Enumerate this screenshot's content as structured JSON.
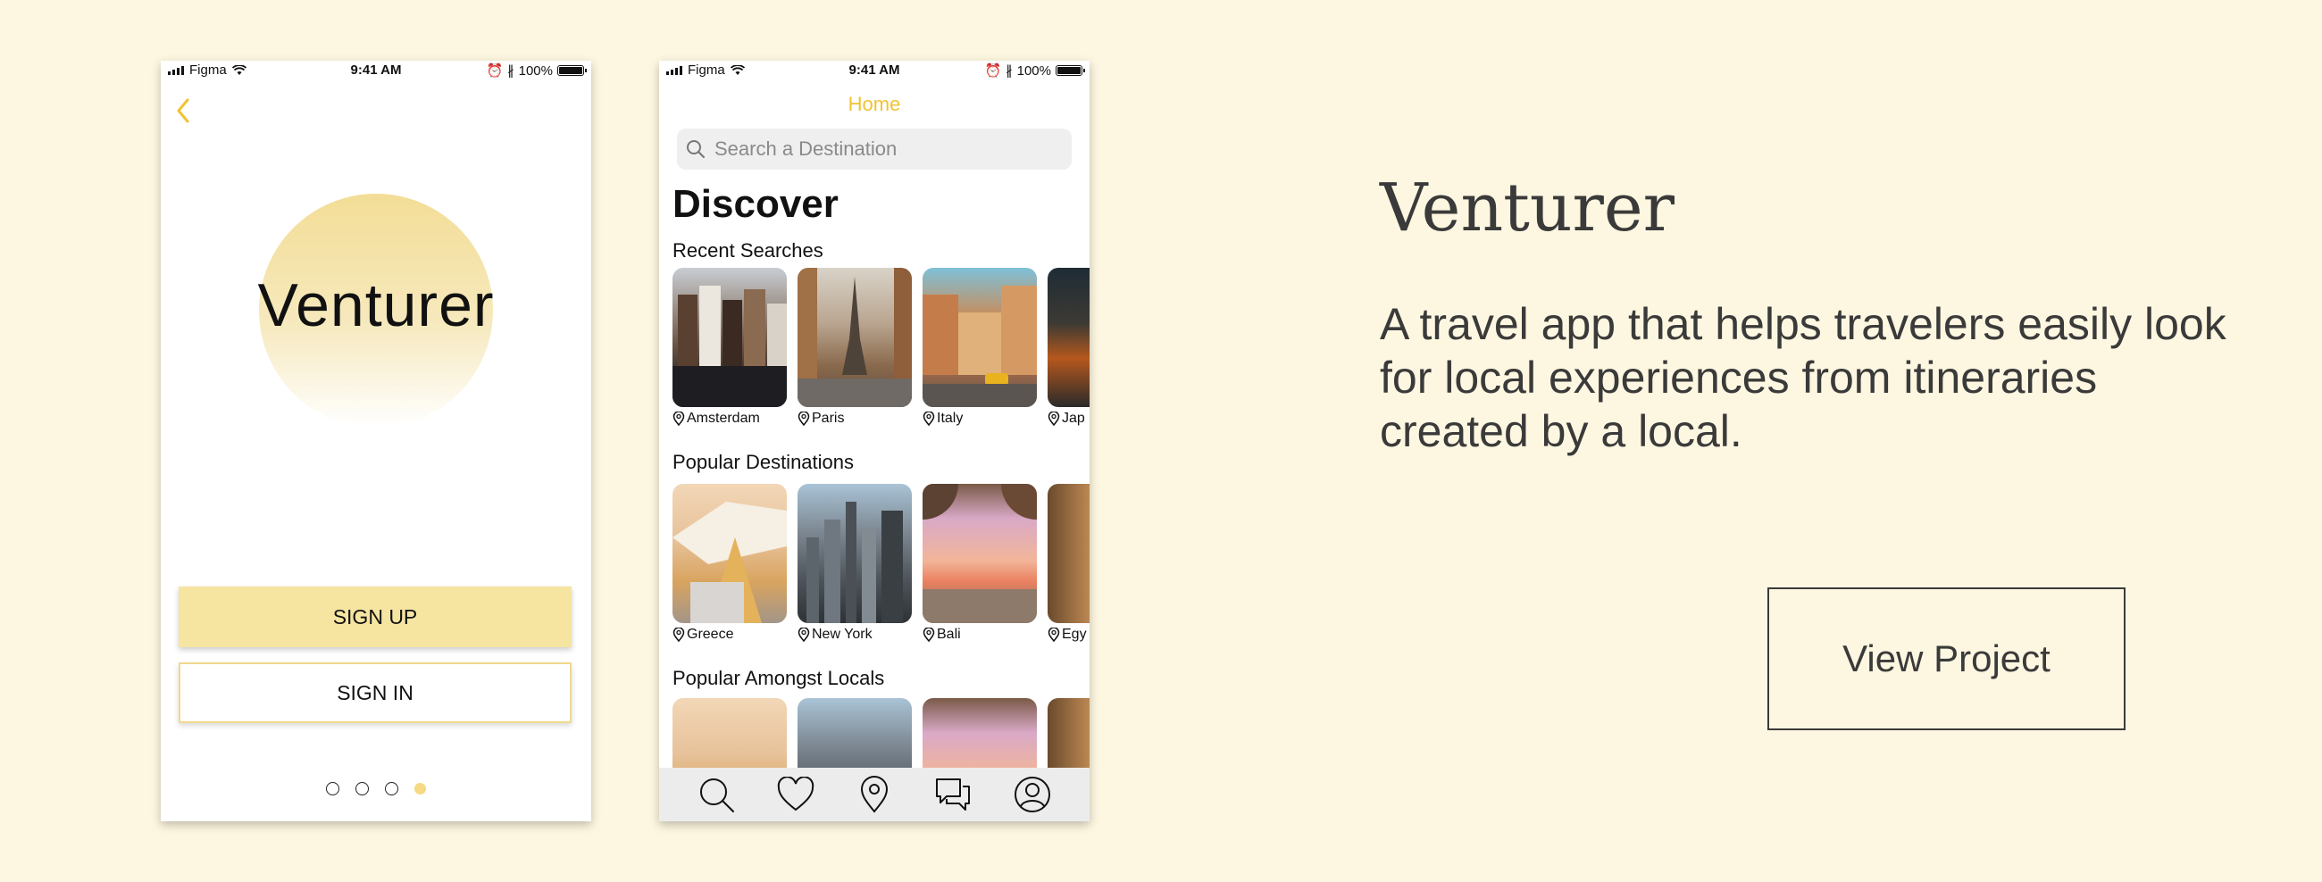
{
  "status_bar": {
    "carrier": "Figma",
    "time": "9:41 AM",
    "battery": "100%"
  },
  "splash": {
    "logo_text": "Venturer",
    "signup_label": "SIGN UP",
    "signin_label": "SIGN IN",
    "page_dots": 4,
    "active_dot": 4
  },
  "home": {
    "title": "Home",
    "search_placeholder": "Search a Destination",
    "heading": "Discover",
    "sections": [
      {
        "title": "Recent Searches",
        "items": [
          "Amsterdam",
          "Paris",
          "Italy",
          "Jap"
        ]
      },
      {
        "title": "Popular Destinations",
        "items": [
          "Greece",
          "New York",
          "Bali",
          "Egy"
        ]
      },
      {
        "title": "Popular Amongst Locals",
        "items": [
          "",
          "",
          "",
          ""
        ]
      }
    ],
    "tabs": [
      "search-icon",
      "heart-icon",
      "location-pin-icon",
      "chat-icon",
      "profile-icon"
    ]
  },
  "project": {
    "title": "Venturer",
    "description": "A travel app that helps travelers easily look for local experiences from itineraries created by a local.",
    "cta": "View Project"
  },
  "colors": {
    "background": "#fdf7e1",
    "accent_yellow": "#f1c232",
    "button_yellow": "#f6e4a1",
    "text_dark": "#3b3a3a"
  }
}
